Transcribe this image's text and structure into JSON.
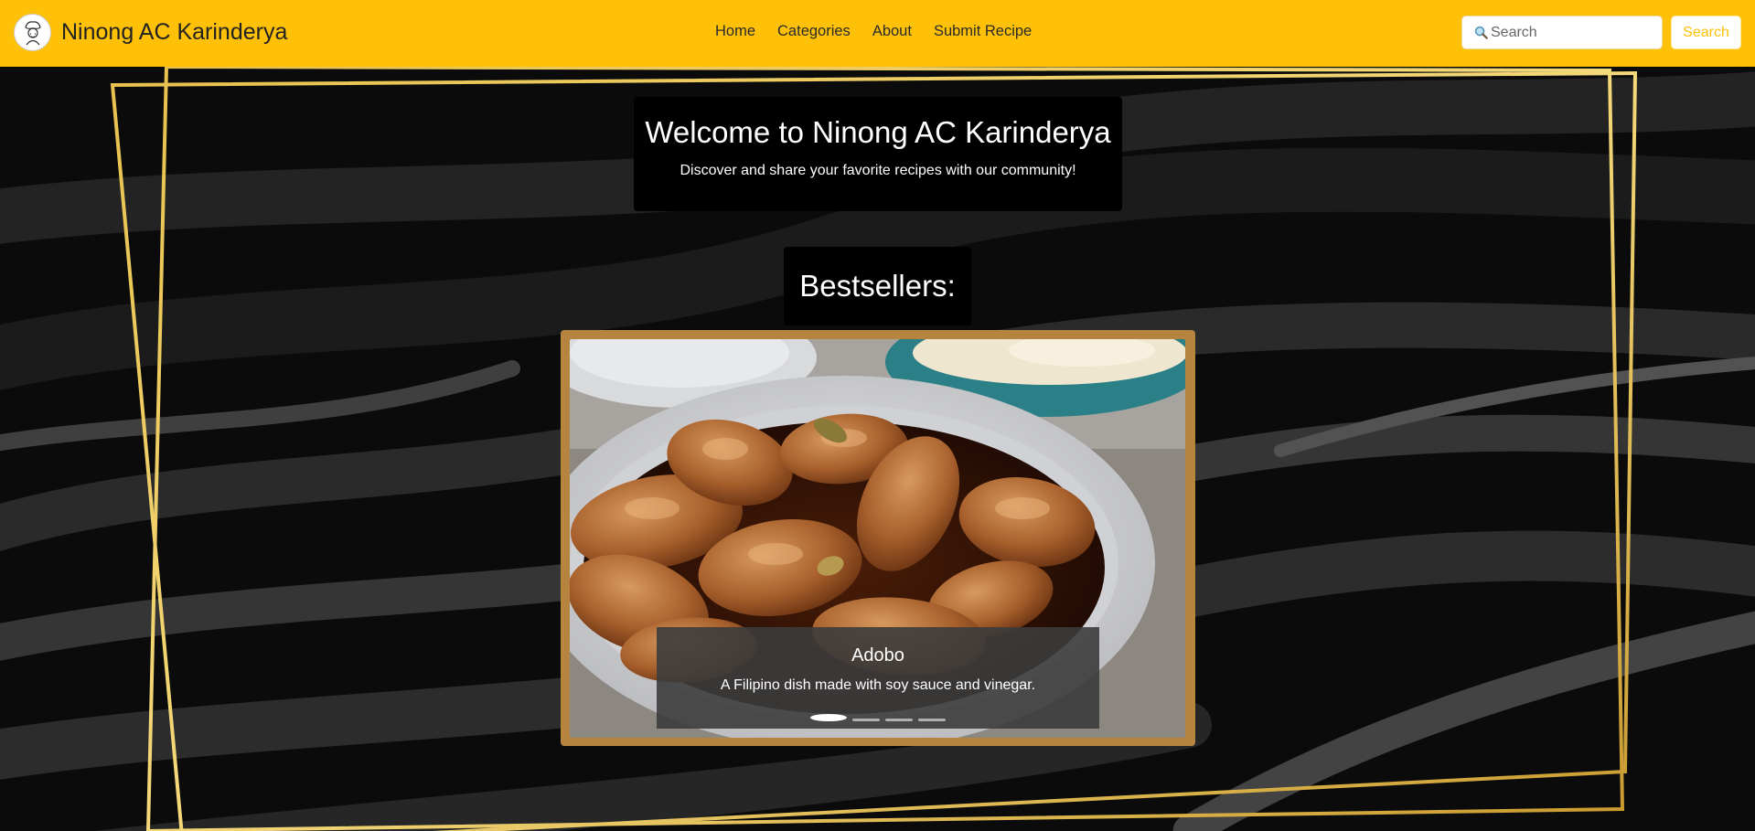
{
  "brand": {
    "name": "Ninong AC Karinderya",
    "logo_icon": "chef-logo-icon"
  },
  "nav": {
    "items": [
      {
        "label": "Home"
      },
      {
        "label": "Categories"
      },
      {
        "label": "About"
      },
      {
        "label": "Submit Recipe"
      }
    ]
  },
  "search": {
    "placeholder": "Search",
    "icon": "magnifier-icon",
    "button_label": "Search"
  },
  "hero": {
    "title": "Welcome to Ninong AC Karinderya",
    "subtitle": "Discover and share your favorite recipes with our community!"
  },
  "bestsellers": {
    "heading": "Bestsellers:",
    "slide": {
      "title": "Adobo",
      "description": "A Filipino dish made with soy sauce and vinegar."
    },
    "indicator_count": 4,
    "active_index": 0
  },
  "colors": {
    "navbar": "#ffc107",
    "accent": "#ffc107",
    "frame": "#b5843f",
    "gold_lines": "#e8c14e"
  }
}
